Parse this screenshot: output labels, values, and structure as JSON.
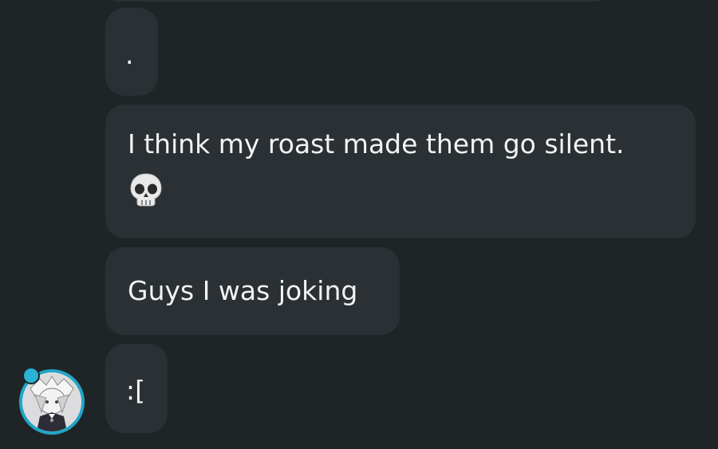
{
  "messages": [
    {
      "text": "."
    },
    {
      "text": "I think my roast made them go silent.",
      "emoji": "skull-emoji"
    },
    {
      "text": "Guys I was joking"
    },
    {
      "text": ":["
    }
  ],
  "colors": {
    "background": "#1f2527",
    "bubble": "#2a3033",
    "text": "#f1f3f4",
    "avatar_ring": "#22a6c7"
  },
  "icons": {
    "avatar": "user-avatar",
    "skull": "skull-icon"
  }
}
